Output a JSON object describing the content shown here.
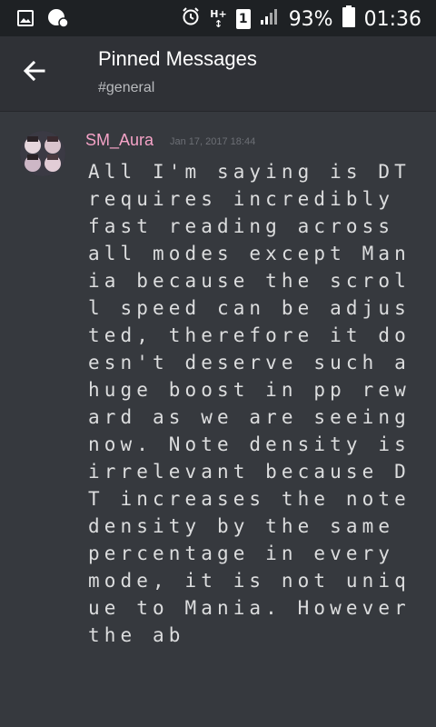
{
  "status_bar": {
    "battery_percent": "93%",
    "time": "01:36",
    "icons": [
      "image-icon",
      "notification-icon",
      "alarm-icon",
      "network-type-icon",
      "sim-1-icon",
      "signal-icon",
      "battery-icon"
    ],
    "network_type": "H+",
    "sim_label": "1"
  },
  "toolbar": {
    "title": "Pinned Messages",
    "subtitle": "#general",
    "back_icon": "back-arrow-icon"
  },
  "message": {
    "author": "SM_Aura",
    "timestamp": "Jan 17, 2017 18:44",
    "author_color": "#f5a3c7",
    "content": "All I'm saying is DT requires incredibly fast reading across all modes except Mania because the scroll speed can be adjusted, therefore it doesn't deserve such a huge boost in pp reward as we are seeing now. Note density is irrelevant because DT increases the note density by the same percentage in every mode, it is not unique to Mania. However the ab"
  }
}
